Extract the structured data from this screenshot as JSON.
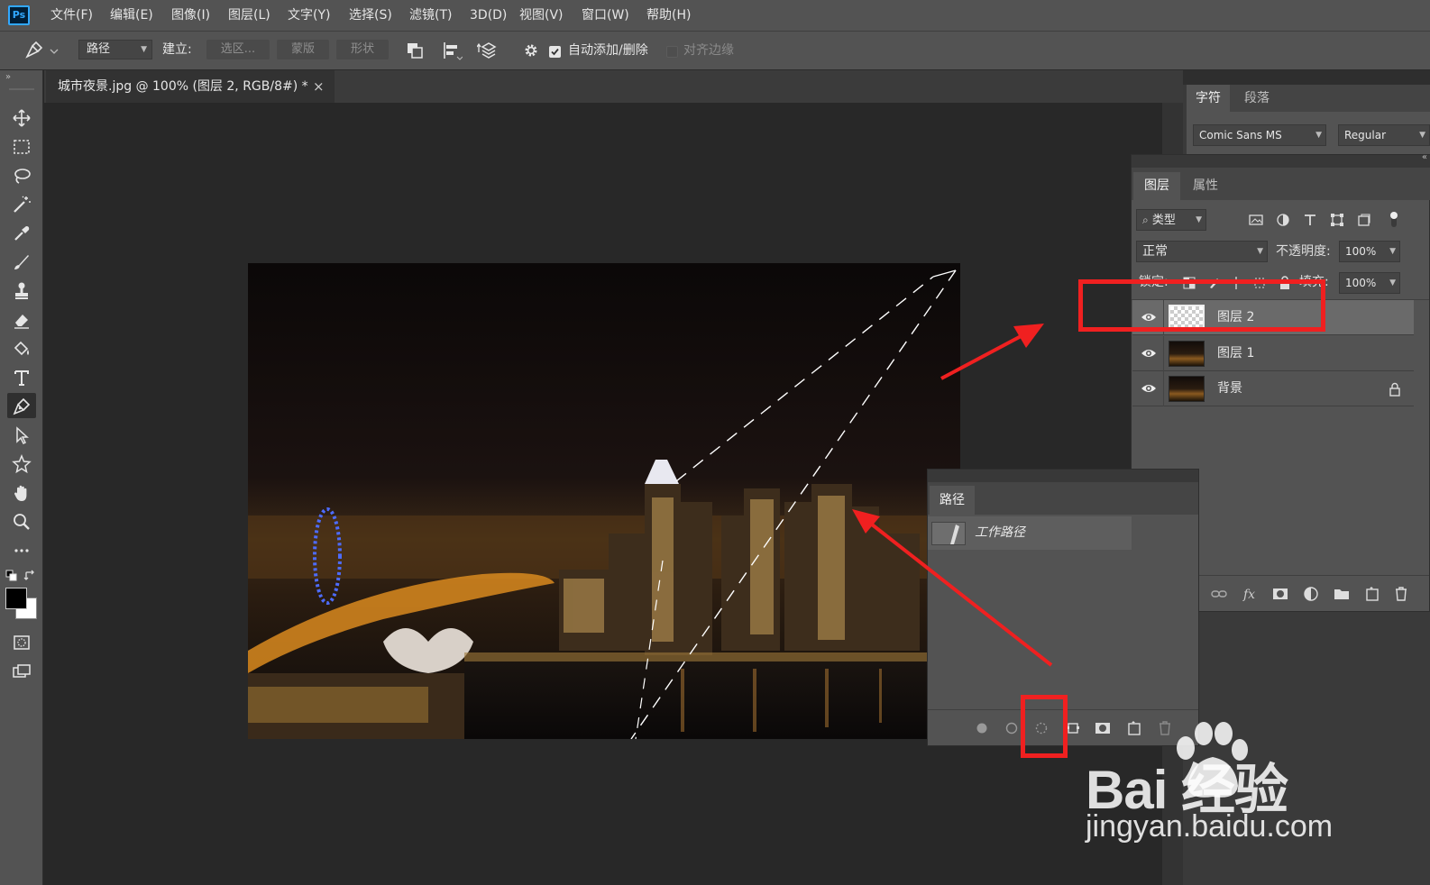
{
  "app": {
    "logo": "Ps"
  },
  "menu": [
    "文件(F)",
    "编辑(E)",
    "图像(I)",
    "图层(L)",
    "文字(Y)",
    "选择(S)",
    "滤镜(T)",
    "3D(D)",
    "视图(V)",
    "窗口(W)",
    "帮助(H)"
  ],
  "options": {
    "mode_value": "路径",
    "make_label": "建立:",
    "selection_btn": "选区...",
    "mask_btn": "蒙版",
    "shape_btn": "形状",
    "auto_add_label": "自动添加/删除",
    "auto_add_checked": true,
    "align_edges_label": "对齐边缘",
    "align_edges_checked": false
  },
  "document": {
    "tab_title": "城市夜景.jpg @ 100% (图层 2, RGB/8#) *",
    "close_glyph": "×"
  },
  "character_panel": {
    "tabs": [
      "字符",
      "段落"
    ],
    "font_family": "Comic Sans MS",
    "font_style": "Regular"
  },
  "layers_panel": {
    "tabs": [
      "图层",
      "属性"
    ],
    "filter_kind": "类型",
    "blend_mode": "正常",
    "opacity_label": "不透明度:",
    "opacity_value": "100%",
    "lock_label": "锁定:",
    "fill_label": "填充:",
    "fill_value": "100%",
    "layers": [
      {
        "name": "图层 2",
        "visible": true,
        "selected": true,
        "thumb": "transparent"
      },
      {
        "name": "图层 1",
        "visible": true,
        "selected": false,
        "thumb": "city"
      },
      {
        "name": "背景",
        "visible": true,
        "selected": false,
        "thumb": "city",
        "locked": true
      }
    ]
  },
  "paths_panel": {
    "title": "路径",
    "paths": [
      {
        "name": "工作路径"
      }
    ]
  },
  "colors": {
    "annotation_red": "#f02020",
    "ps_blue": "#31a8ff",
    "foreground": "#000000",
    "background": "#ffffff"
  },
  "watermark": {
    "brand": "Bai 经验",
    "url": "jingyan.baidu.com"
  }
}
